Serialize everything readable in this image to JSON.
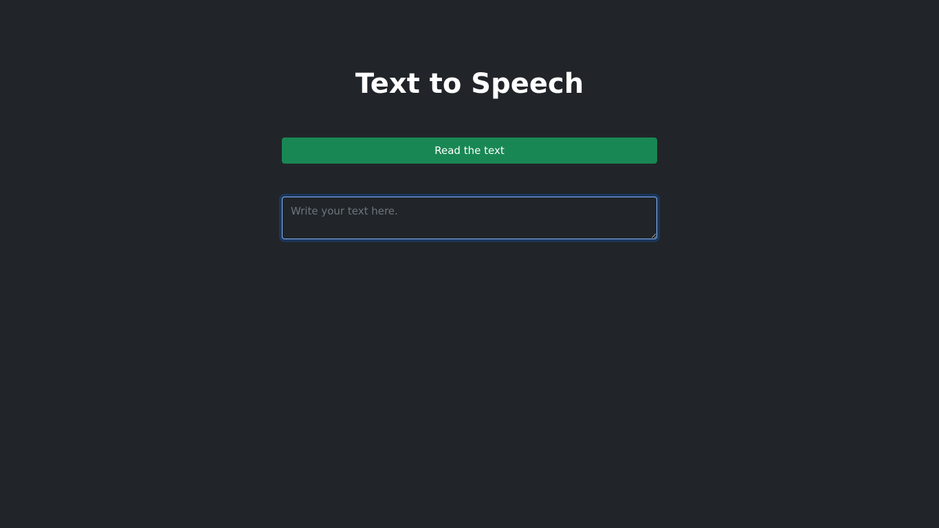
{
  "page": {
    "title": "Text to Speech"
  },
  "controls": {
    "read_button_label": "Read the text",
    "text_input": {
      "value": "",
      "placeholder": "Write your text here."
    }
  },
  "colors": {
    "background": "#212529",
    "button": "#198754",
    "focus_border": "#86b7fe"
  }
}
